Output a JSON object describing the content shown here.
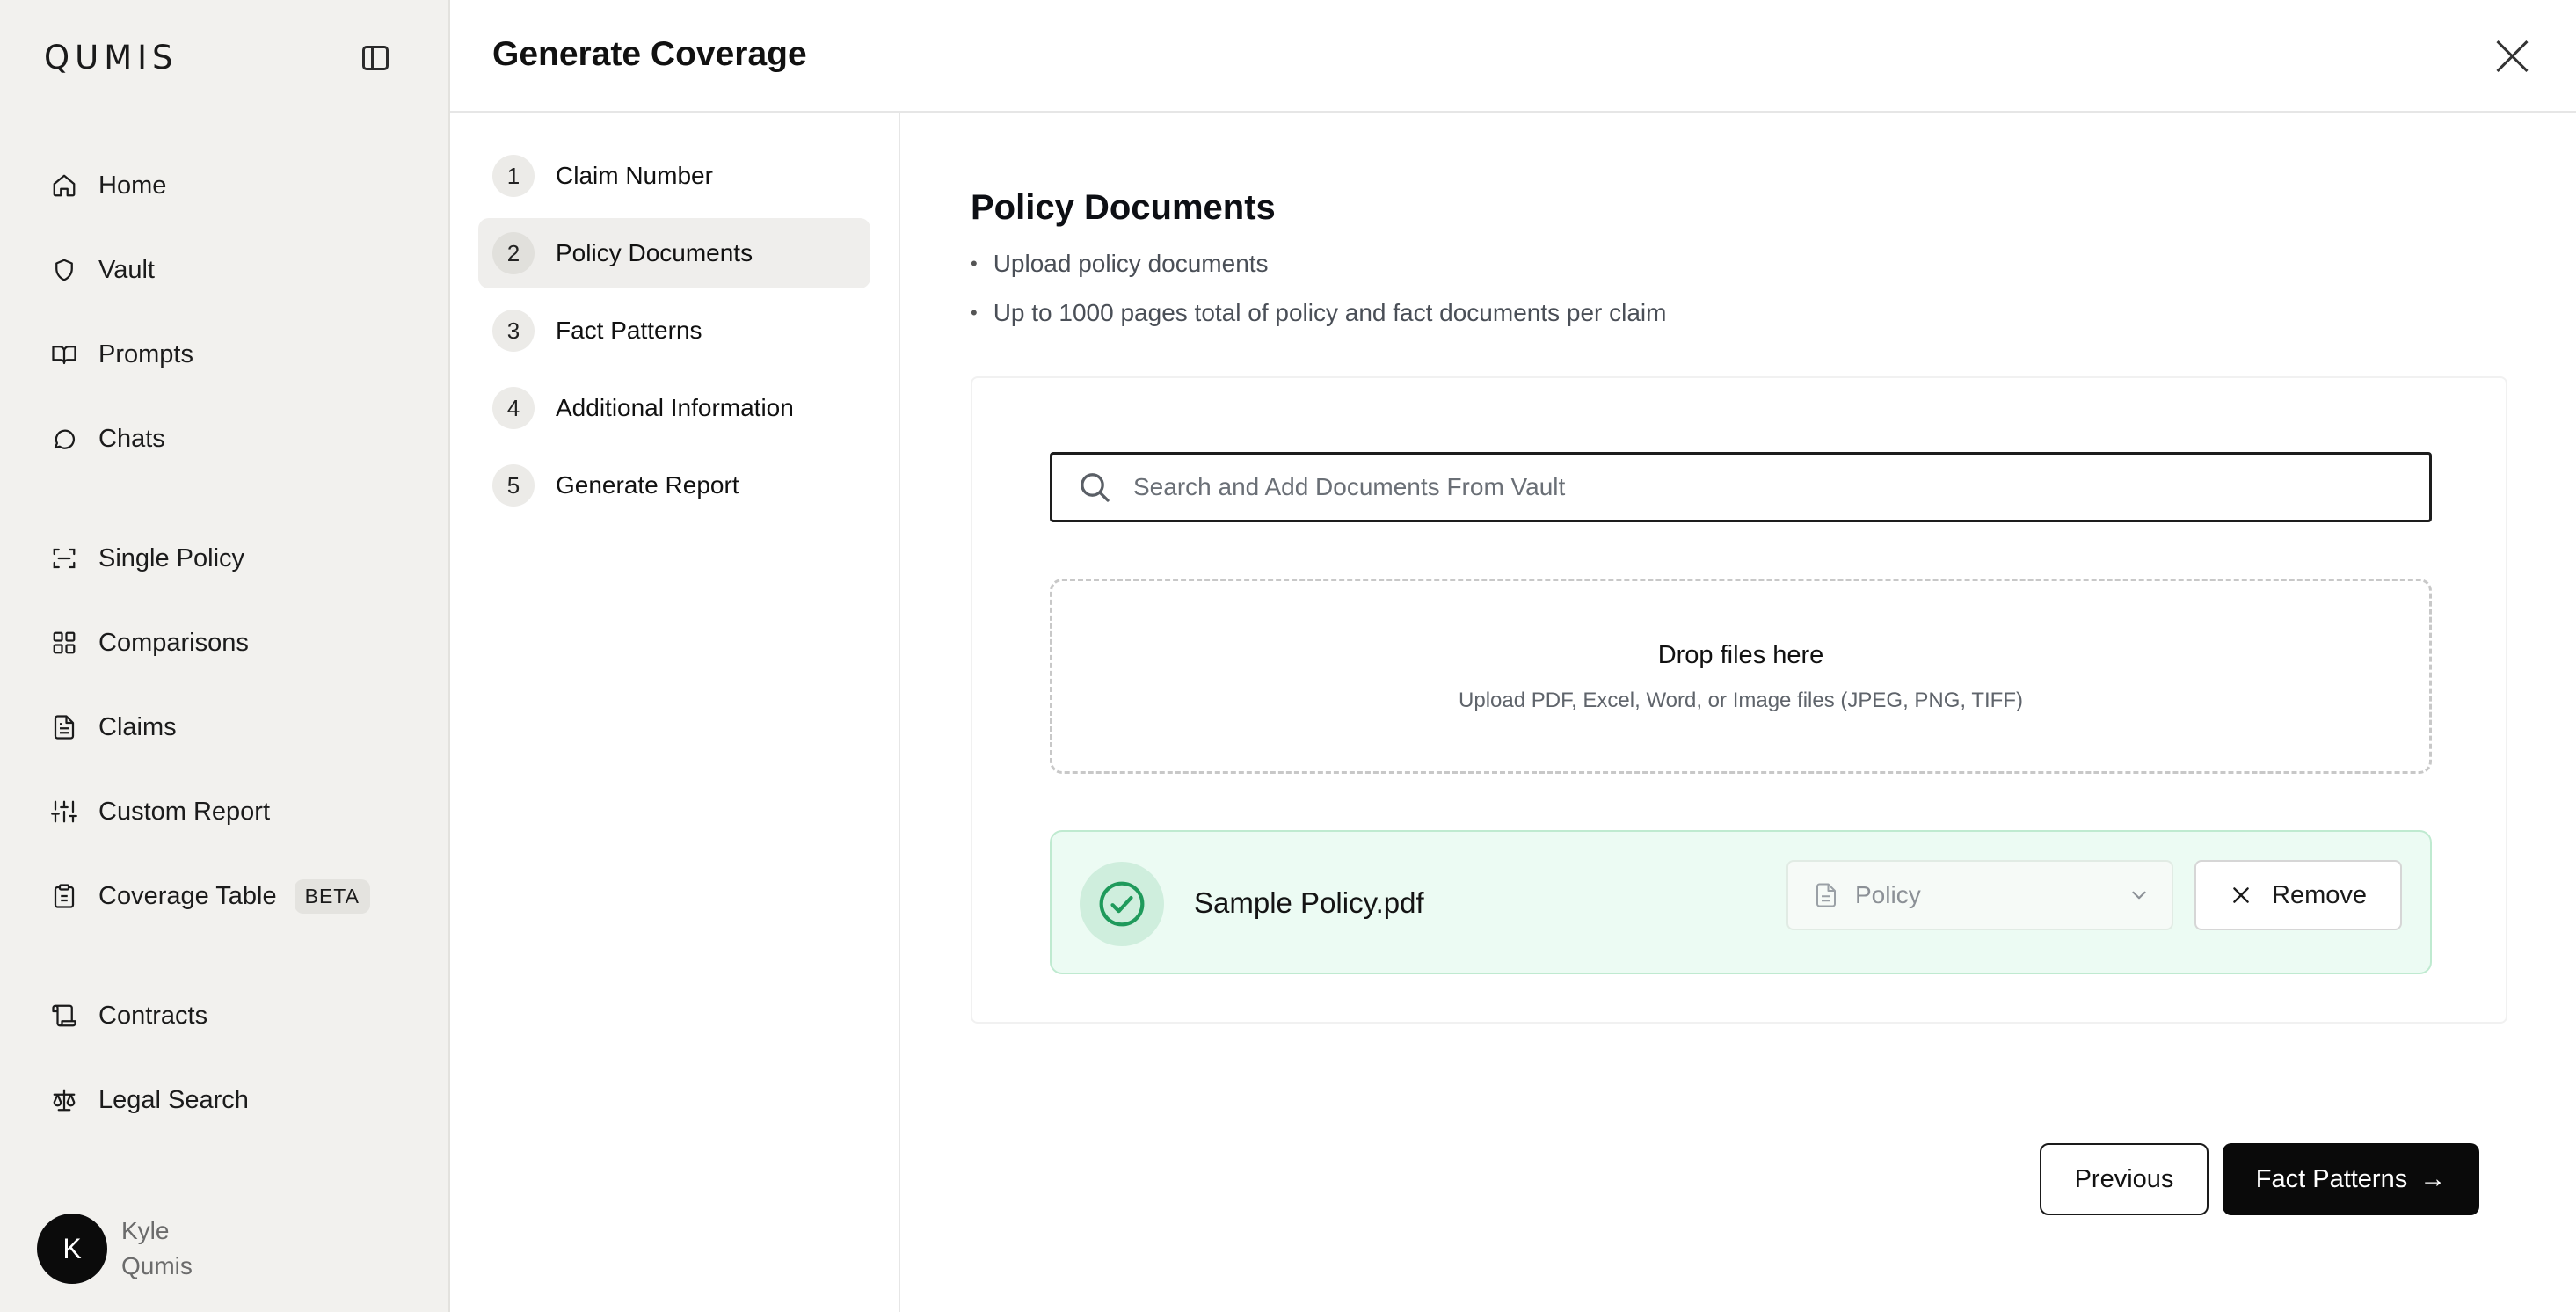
{
  "app": {
    "logo": "QUMIS"
  },
  "sidebar": {
    "items": [
      {
        "label": "Home",
        "icon": "home-icon"
      },
      {
        "label": "Vault",
        "icon": "shield-icon"
      },
      {
        "label": "Prompts",
        "icon": "book-icon"
      },
      {
        "label": "Chats",
        "icon": "chat-icon"
      },
      {
        "label": "Single Policy",
        "icon": "scan-icon"
      },
      {
        "label": "Comparisons",
        "icon": "grid-icon"
      },
      {
        "label": "Claims",
        "icon": "document-icon"
      },
      {
        "label": "Custom Report",
        "icon": "sliders-icon"
      },
      {
        "label": "Coverage Table",
        "icon": "clipboard-icon",
        "badge": "BETA"
      },
      {
        "label": "Contracts",
        "icon": "scroll-icon"
      },
      {
        "label": "Legal Search",
        "icon": "scale-icon"
      }
    ],
    "user": {
      "initial": "K",
      "first_name": "Kyle",
      "last_name": "Qumis"
    }
  },
  "header": {
    "title": "Generate Coverage"
  },
  "steps": [
    {
      "number": "1",
      "label": "Claim Number",
      "active": false
    },
    {
      "number": "2",
      "label": "Policy Documents",
      "active": true
    },
    {
      "number": "3",
      "label": "Fact Patterns",
      "active": false
    },
    {
      "number": "4",
      "label": "Additional Information",
      "active": false
    },
    {
      "number": "5",
      "label": "Generate Report",
      "active": false
    }
  ],
  "main": {
    "title": "Policy Documents",
    "bullets": [
      "Upload policy documents",
      "Up to 1000 pages total of policy and fact documents per claim"
    ],
    "search": {
      "placeholder": "Search and Add Documents From Vault",
      "value": ""
    },
    "dropzone": {
      "title": "Drop files here",
      "subtitle": "Upload PDF, Excel, Word, or Image files (JPEG, PNG, TIFF)"
    },
    "files": [
      {
        "name": "Sample Policy.pdf",
        "type": "Policy",
        "remove_label": "Remove",
        "status": "uploaded"
      }
    ]
  },
  "footer": {
    "previous_label": "Previous",
    "next_label": "Fact Patterns"
  },
  "colors": {
    "accent": "#0a0a0a",
    "success_bg": "#ecfbf3",
    "success_icon": "#1f9a5b",
    "sidebar_bg": "#f2f1ee"
  }
}
